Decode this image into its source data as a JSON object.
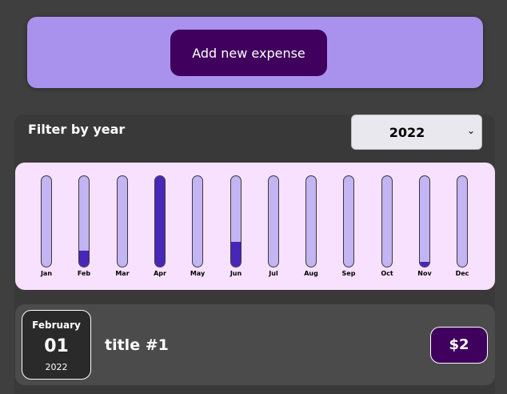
{
  "new_expense": {
    "button_label": "Add new expense"
  },
  "filter": {
    "label": "Filter by year",
    "selected_year": "2022"
  },
  "chart_data": {
    "type": "bar",
    "categories": [
      "Jan",
      "Feb",
      "Mar",
      "Apr",
      "May",
      "Jun",
      "Jul",
      "Aug",
      "Sep",
      "Oct",
      "Nov",
      "Dec"
    ],
    "values": [
      0,
      0.18,
      0,
      1.0,
      0,
      0.27,
      0,
      0,
      0,
      0,
      0.05,
      0
    ],
    "ylim": [
      0,
      1
    ]
  },
  "expenses": [
    {
      "month": "February",
      "day": "01",
      "year": "2022",
      "title": "title #1",
      "amount": "$2"
    }
  ],
  "colors": {
    "accent": "#40005d",
    "bar_fill": "#4826b9",
    "bar_track": "#c3b4f3",
    "chart_bg": "#f8e1ff",
    "new_expense_bg": "#a892ee"
  },
  "icons": {
    "select_chevron": "chevron-down-icon"
  }
}
